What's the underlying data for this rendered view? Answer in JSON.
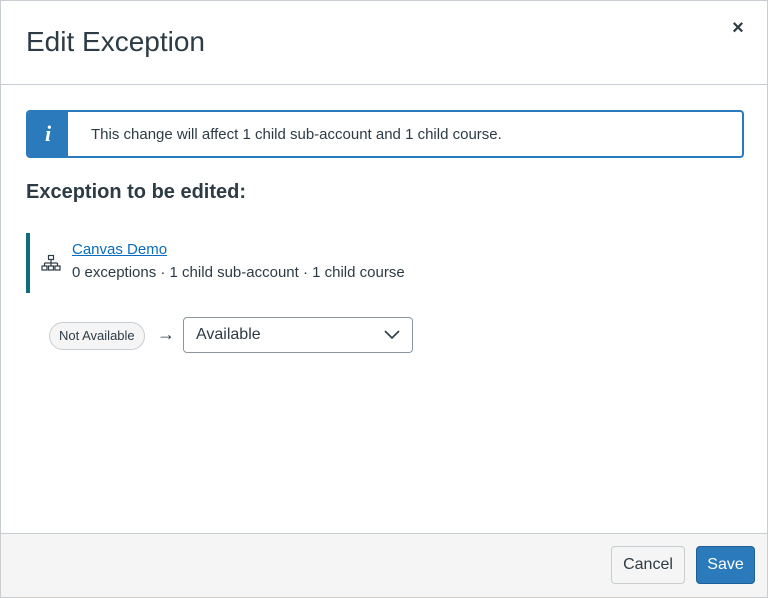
{
  "dialog": {
    "title": "Edit Exception",
    "close_label": "×"
  },
  "alert": {
    "icon_label": "i",
    "message": "This change will affect 1 child sub-account and 1 child course."
  },
  "section": {
    "title": "Exception to be edited:"
  },
  "account": {
    "name": "Canvas Demo",
    "meta": "0 exceptions · 1 child sub-account · 1 child course",
    "icon": "org-chart-icon"
  },
  "change": {
    "current_status": "Not Available",
    "arrow": "→",
    "selected_value": "Available"
  },
  "footer": {
    "cancel_label": "Cancel",
    "save_label": "Save"
  },
  "colors": {
    "accent": "#2b7abc",
    "link": "#0a6cbf",
    "account_bar": "#0e6e79",
    "text": "#2d3b45"
  }
}
